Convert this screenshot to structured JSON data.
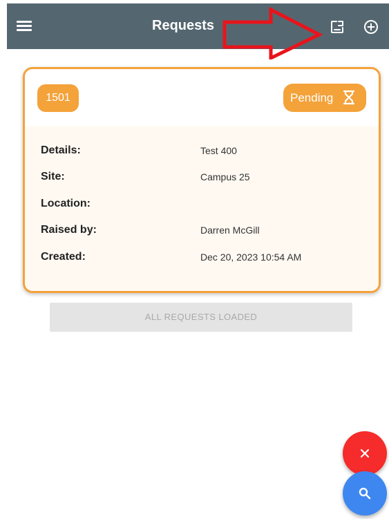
{
  "header": {
    "title": "Requests",
    "menu_icon": "menu-icon",
    "report_icon": "report-icon",
    "add_icon": "add-circle-icon",
    "background_color": "#546770"
  },
  "request": {
    "id": "1501",
    "status": "Pending",
    "status_icon": "hourglass-icon",
    "accent_color": "#f4a23a",
    "fields": [
      {
        "label": "Details:",
        "value": "Test 400"
      },
      {
        "label": "Site:",
        "value": "Campus 25"
      },
      {
        "label": "Location:",
        "value": ""
      },
      {
        "label": "Raised by:",
        "value": "Darren McGill"
      },
      {
        "label": "Created:",
        "value": "Dec 20, 2023 10:54 AM"
      }
    ]
  },
  "list_footer": {
    "label": "ALL REQUESTS LOADED"
  },
  "fabs": {
    "close_icon": "close-icon",
    "close_color": "#f62b2b",
    "search_icon": "search-icon",
    "search_color": "#3f87f0"
  },
  "annotation": {
    "icon": "red-arrow-annotation",
    "color": "#e8141c"
  }
}
